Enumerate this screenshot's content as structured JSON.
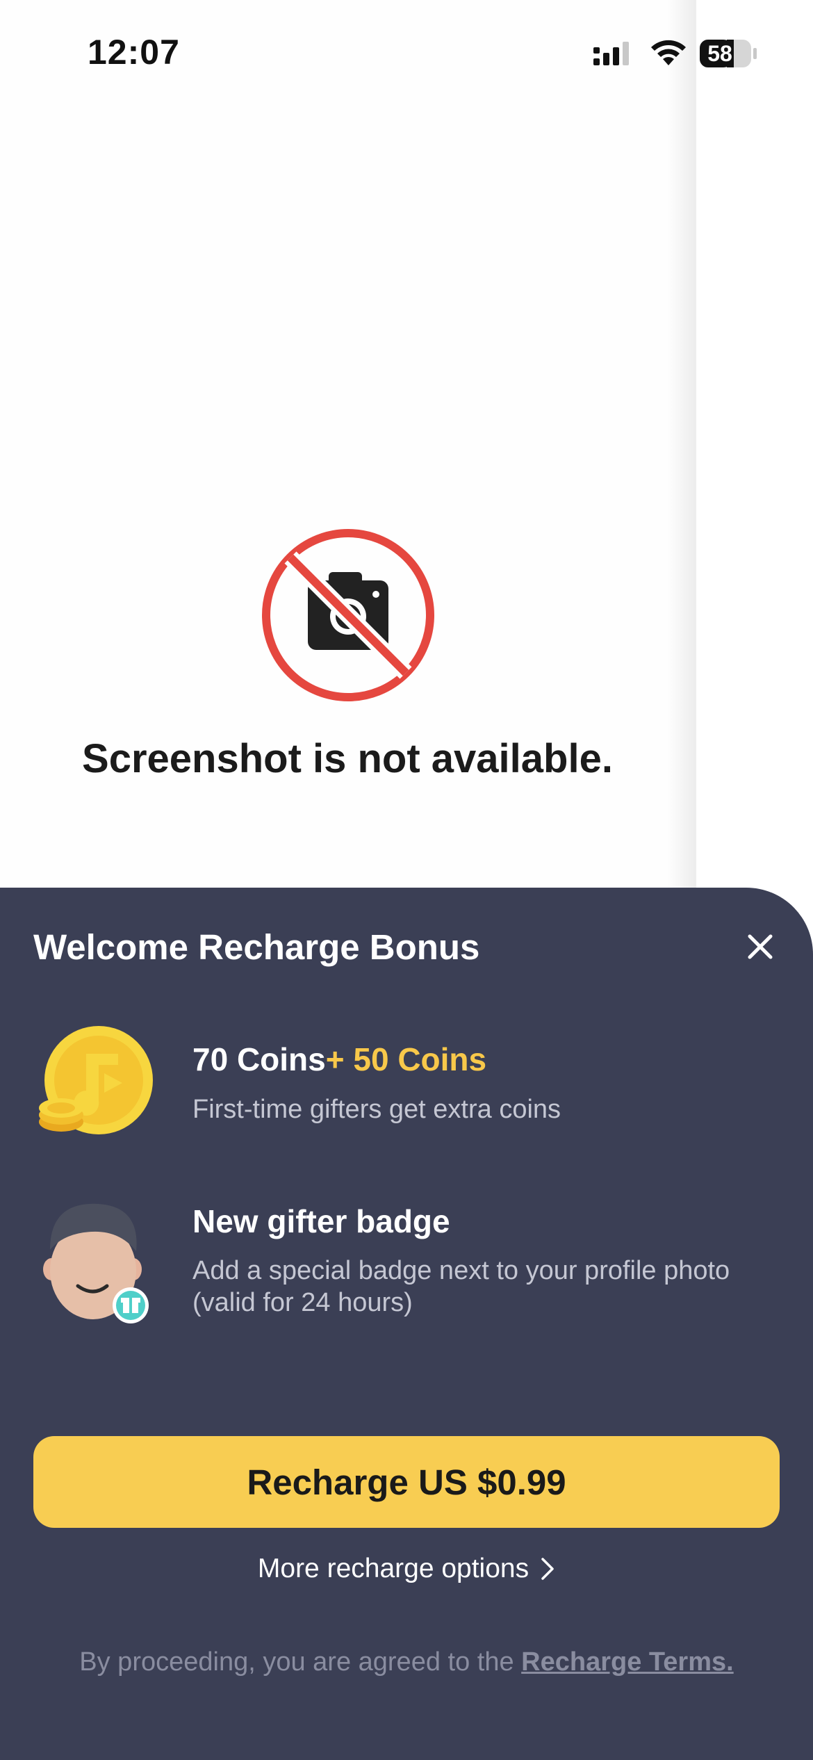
{
  "status_bar": {
    "time": "12:07",
    "battery": "58",
    "icons": [
      "signal-icon",
      "wifi-icon",
      "battery-icon"
    ]
  },
  "placeholder": {
    "message": "Screenshot is not available.",
    "icon": "no-camera-icon"
  },
  "sheet": {
    "title": "Welcome Recharge Bonus",
    "close_icon": "close-icon",
    "benefits": [
      {
        "icon": "coin-icon",
        "title_base": "70 Coins",
        "title_bonus": "+ 50 Coins",
        "subtitle": "First-time gifters get extra coins"
      },
      {
        "icon": "avatar-badge-icon",
        "title": "New gifter badge",
        "subtitle_line1": "Add a special badge next to your profile photo",
        "subtitle_line2": "(valid for 24 hours)"
      }
    ],
    "recharge_label": "Recharge US $0.99",
    "more_options_label": "More recharge options",
    "terms_prefix": "By proceeding, you are agreed to the ",
    "terms_link": "Recharge Terms."
  },
  "colors": {
    "sheet_bg": "#3b3f55",
    "accent": "#f8cd52",
    "bonus_text": "#f8c84a",
    "no_sign_red": "#e5473f"
  }
}
